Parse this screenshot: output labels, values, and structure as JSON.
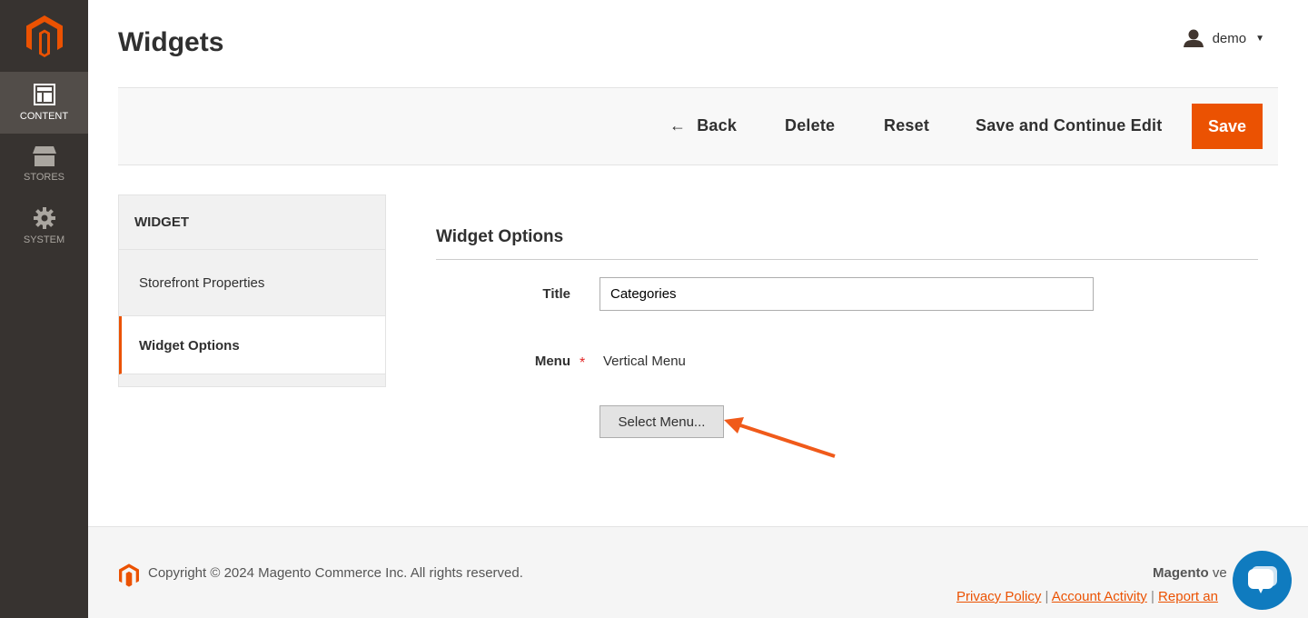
{
  "sidebar": {
    "items": [
      {
        "label": "CONTENT",
        "icon": "layout-icon"
      },
      {
        "label": "STORES",
        "icon": "store-icon"
      },
      {
        "label": "SYSTEM",
        "icon": "gear-icon"
      }
    ]
  },
  "header": {
    "title": "Widgets",
    "user": "demo"
  },
  "toolbar": {
    "back": "Back",
    "delete": "Delete",
    "reset": "Reset",
    "save_continue": "Save and Continue Edit",
    "save": "Save"
  },
  "tabs": {
    "heading": "WIDGET",
    "items": [
      {
        "label": "Storefront Properties"
      },
      {
        "label": "Widget Options"
      }
    ]
  },
  "form": {
    "section_title": "Widget Options",
    "title_label": "Title",
    "title_value": "Categories",
    "menu_label": "Menu",
    "menu_value": "Vertical Menu",
    "select_button": "Select Menu..."
  },
  "footer": {
    "copyright": "Copyright © 2024 Magento Commerce Inc. All rights reserved.",
    "brand": "Magento",
    "version_prefix": "ve",
    "links": [
      "Privacy Policy",
      "Account Activity",
      "Report an"
    ]
  },
  "colors": {
    "accent": "#eb5202",
    "sidebar": "#373330",
    "chat": "#0f7bbf"
  }
}
